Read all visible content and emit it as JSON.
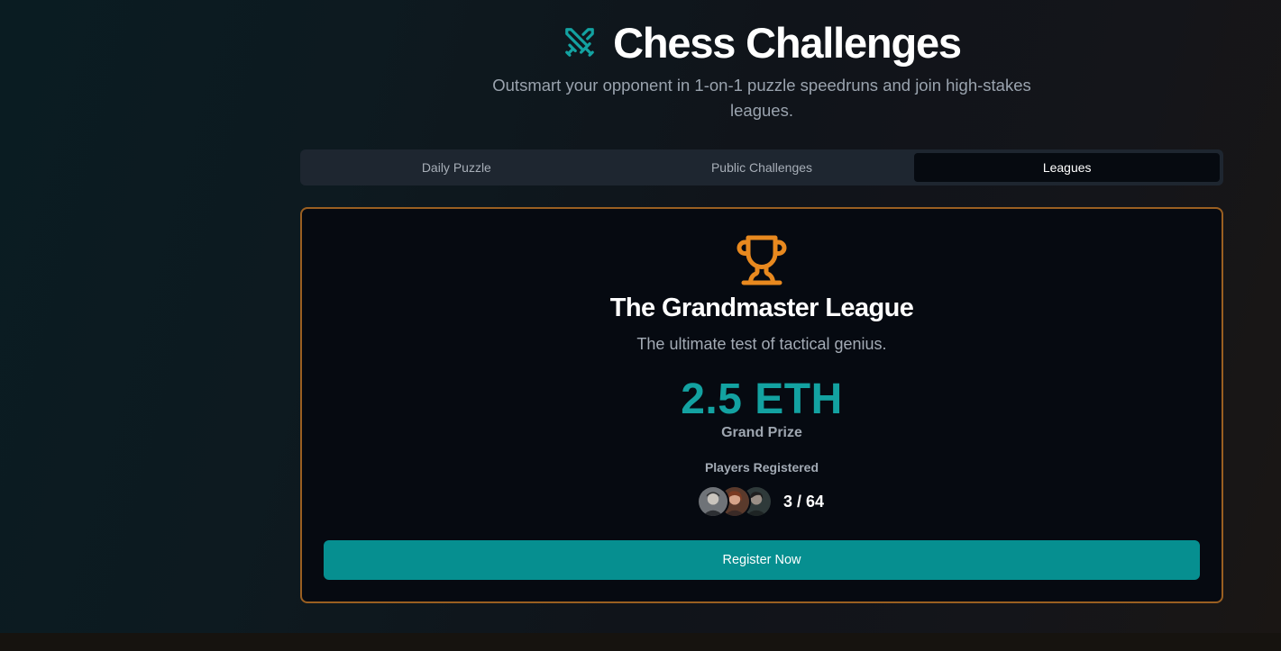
{
  "header": {
    "title": "Chess Challenges",
    "subtitle": "Outsmart your opponent in 1-on-1 puzzle speedruns and join high-stakes leagues.",
    "icon": "crossed-swords-icon"
  },
  "tabs": [
    {
      "label": "Daily Puzzle",
      "active": false
    },
    {
      "label": "Public Challenges",
      "active": false
    },
    {
      "label": "Leagues",
      "active": true
    }
  ],
  "league": {
    "icon": "trophy-icon",
    "title": "The Grandmaster League",
    "description": "The ultimate test of tactical genius.",
    "prize": "2.5 ETH",
    "prize_label": "Grand Prize",
    "players_label": "Players Registered",
    "players_count": "3 / 64",
    "register_label": "Register Now"
  },
  "colors": {
    "accent": "#13a2a1",
    "button": "#068f90",
    "card_border": "#9a5f21",
    "trophy": "#e8891f"
  }
}
